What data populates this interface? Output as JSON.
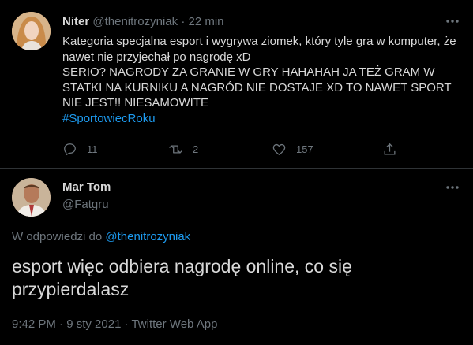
{
  "tweet1": {
    "author_name": "Niter",
    "handle": "@thenitrozyniak",
    "separator": "·",
    "time_ago": "22 min",
    "text_lines": [
      "Kategoria specjalna esport i wygrywa ziomek, który tyle gra w komputer, że nawet nie przyjechał po nagrodę xD",
      "SERIO? NAGRODY ZA GRANIE W GRY HAHAHAH JA TEŻ GRAM W STATKI NA KURNIKU A NAGRÓD NIE DOSTAJE XD TO NAWET SPORT NIE JEST!! NIESAMOWITE"
    ],
    "hashtag": "#SportowiecRoku",
    "actions": {
      "reply_icon": "reply-icon",
      "reply_count": "11",
      "retweet_icon": "retweet-icon",
      "retweet_count": "2",
      "like_icon": "like-icon",
      "like_count": "157",
      "share_icon": "share-icon"
    }
  },
  "tweet2": {
    "author_name": "Mar Tom",
    "handle": "@Fatgru",
    "reply_prefix": "W odpowiedzi do",
    "reply_to": "@thenitrozyniak",
    "text": "esport więc odbiera nagrodę online, co się przypierdalasz",
    "timestamp": "9:42 PM · 9 sty 2021 · Twitter Web App"
  },
  "colors": {
    "background": "#000000",
    "text": "#d9d9d9",
    "muted": "#6e767d",
    "link": "#1d9bf0",
    "divider": "#2f3336"
  }
}
